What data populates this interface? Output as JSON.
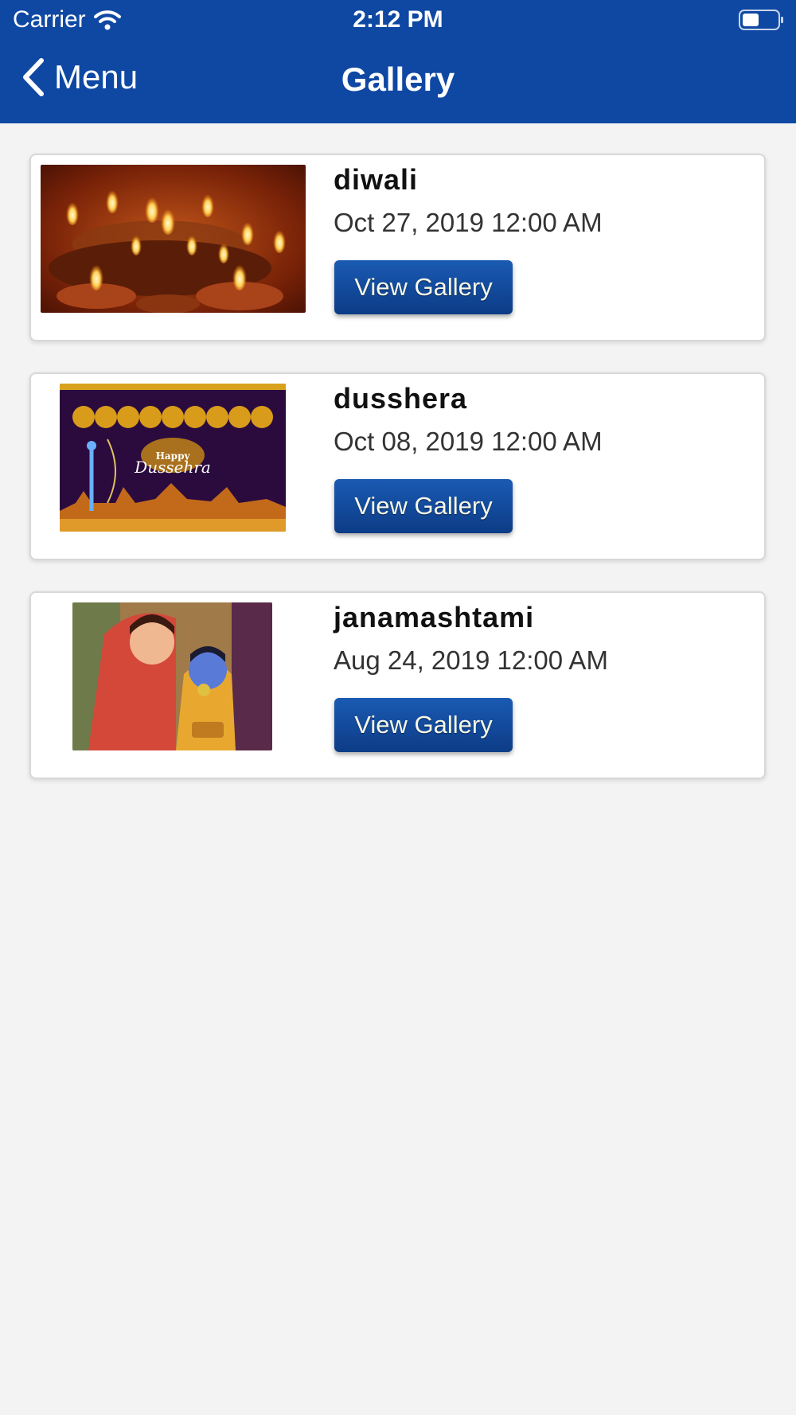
{
  "status_bar": {
    "carrier": "Carrier",
    "time": "2:12 PM"
  },
  "nav": {
    "back_label": "Menu",
    "title": "Gallery"
  },
  "colors": {
    "header": "#0f48a3",
    "button": "#134c9c",
    "background": "#f3f3f3"
  },
  "gallery": [
    {
      "title": "diwali",
      "date": "Oct 27, 2019 12:00 AM",
      "button": "View Gallery",
      "thumb_icon": "diwali-lamps-image"
    },
    {
      "title": "dusshera",
      "date": "Oct 08, 2019 12:00 AM",
      "button": "View Gallery",
      "thumb_icon": "dussehra-image",
      "thumb_text": [
        "Happy",
        "Dussehra"
      ]
    },
    {
      "title": "janamashtami",
      "date": "Aug 24, 2019 12:00 AM",
      "button": "View Gallery",
      "thumb_icon": "krishna-image"
    }
  ]
}
